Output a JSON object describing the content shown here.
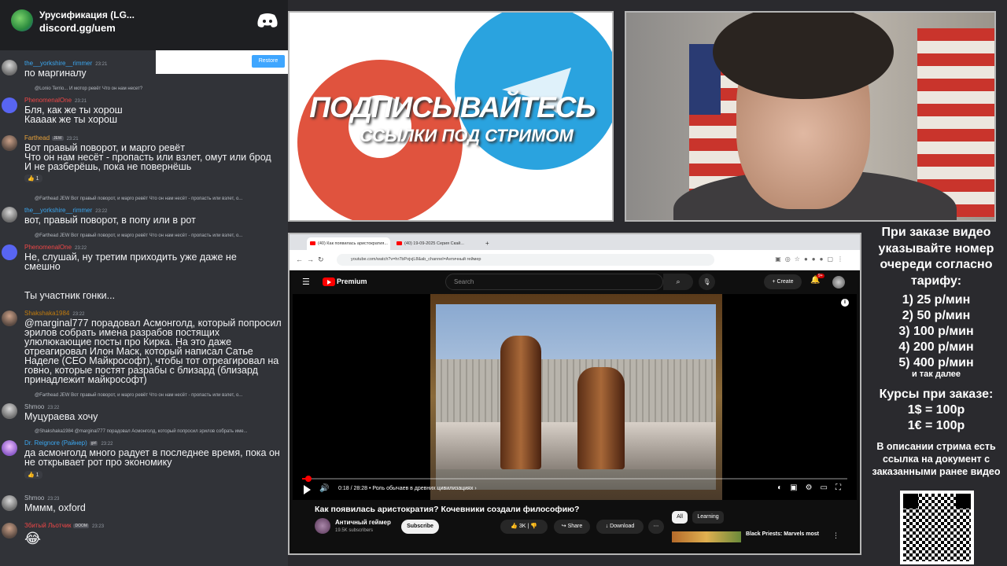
{
  "server": {
    "name": "Урусификация (LG...",
    "link": "discord.gg/uem"
  },
  "restore_label": "Restore",
  "chat": [
    {
      "user": "the__yorkshire__rimmer",
      "time": "23:21",
      "text": "по маргиналу"
    },
    {
      "reply": "@Lonio Terrio... И мотор ревёт Что он нам несет?",
      "user": "PhenomenalOne",
      "time": "23:21",
      "text": "Бля, как же ты хорош\nКаааак же ты хорош"
    },
    {
      "user": "Farthead",
      "badge": "JEW",
      "time": "23:21",
      "text": "Вот правый поворот, и марго ревёт\nЧто он нам несёт - пропасть или взлет, омут или брод\nИ не разберёшь, пока не повернёшь",
      "reaction": "1"
    },
    {
      "reply": "@Farthead JEW Вот правый поворот, и марго ревёт Что он нам несёт - пропасть или взлет, о...",
      "user": "the__yorkshire__rimmer",
      "time": "23:22",
      "text": "вот, правый поворот, в попу или в рот"
    },
    {
      "reply": "@Farthead JEW Вот правый поворот, и марго ревёт Что он нам несёт - пропасть или взлет, о...",
      "user": "PhenomenalOne",
      "time": "23:22",
      "text": "Не, слушай, ну третим приходить уже даже не смешно"
    },
    {
      "text": "Ты участник гонки..."
    },
    {
      "user": "Shakshaka1984",
      "time": "23:22",
      "text": "@marginal777 порадовал Асмонголд, который попросил эрилов собрать имена разрабов постящих улюлюкающие посты про Кирка. На это даже отреагировал Илон Маск, который написал Сатье Наделе (CEO Майкрософт), чтобы тот отреагировал на говно, которые постят разрабы с близард (близард принадлежит майкрософт)"
    },
    {
      "reply": "@Farthead JEW Вот правый поворот, и марго ревёт Что он нам несёт - пропасть или взлет, о...",
      "user": "Shmoo",
      "time": "23:22",
      "text": "Муцураева хочу"
    },
    {
      "reply": "@Shakshaka1984 @marginal777 порадовал Асмонголд, который попросил эрилов собрать име...",
      "user": "Dr. Reignore (Райнер)",
      "badge": "girl",
      "time": "23:22",
      "text": "да асмонголд много радует в последнее время, пока он не открывает рот про экономику",
      "reaction": "1"
    },
    {
      "user": "Shmoo",
      "time": "23:23",
      "text": "Мммм, oxford"
    },
    {
      "user": "Збитый Льотчик",
      "badge": "DOOM",
      "time": "23:23",
      "text": "😂"
    }
  ],
  "promo": {
    "big": "ПОДПИСЫВАЙТЕСЬ",
    "small": "ССЫЛКИ ПОД СТРИМОМ"
  },
  "browser": {
    "tabs": [
      "(40) Как появилась аристократия...",
      "(40) 19-09-2025 Серия Скай..."
    ],
    "url": "youtube.com/watch?v=hr7bPojvjL8&ab_channel=Античный геймер",
    "yt": {
      "brand": "Premium",
      "search_placeholder": "Search",
      "create_label": "Create",
      "notif_count": "9+",
      "time": "0:18 / 28:28",
      "chapter": "• Роль обычаев в древних цивилизациях ›",
      "title": "Как появилась аристократия? Кочевники создали философию?",
      "channel": "Античный геймер",
      "subs": "19.5K subscribers",
      "subscribe_label": "Subscribe",
      "likes": "3K",
      "share_label": "Share",
      "download_label": "Download",
      "chip_all": "All",
      "chip_learning": "Learning",
      "rec_title": "Black Priests: Marvels most"
    }
  },
  "info": {
    "head": "При заказе видео указывайте номер очереди согласно тарифу:",
    "prices": [
      "1) 25 р/мин",
      "2) 50 р/мин",
      "3) 100 р/мин",
      "4) 200 р/мин",
      "5) 400 р/мин"
    ],
    "etc": "и так далее",
    "rates_head": "Курсы при заказе:",
    "rates": [
      "1$ = 100р",
      "1€ = 100р"
    ],
    "desc": "В описании стрима есть ссылка на документ с заказанными ранее видео"
  }
}
